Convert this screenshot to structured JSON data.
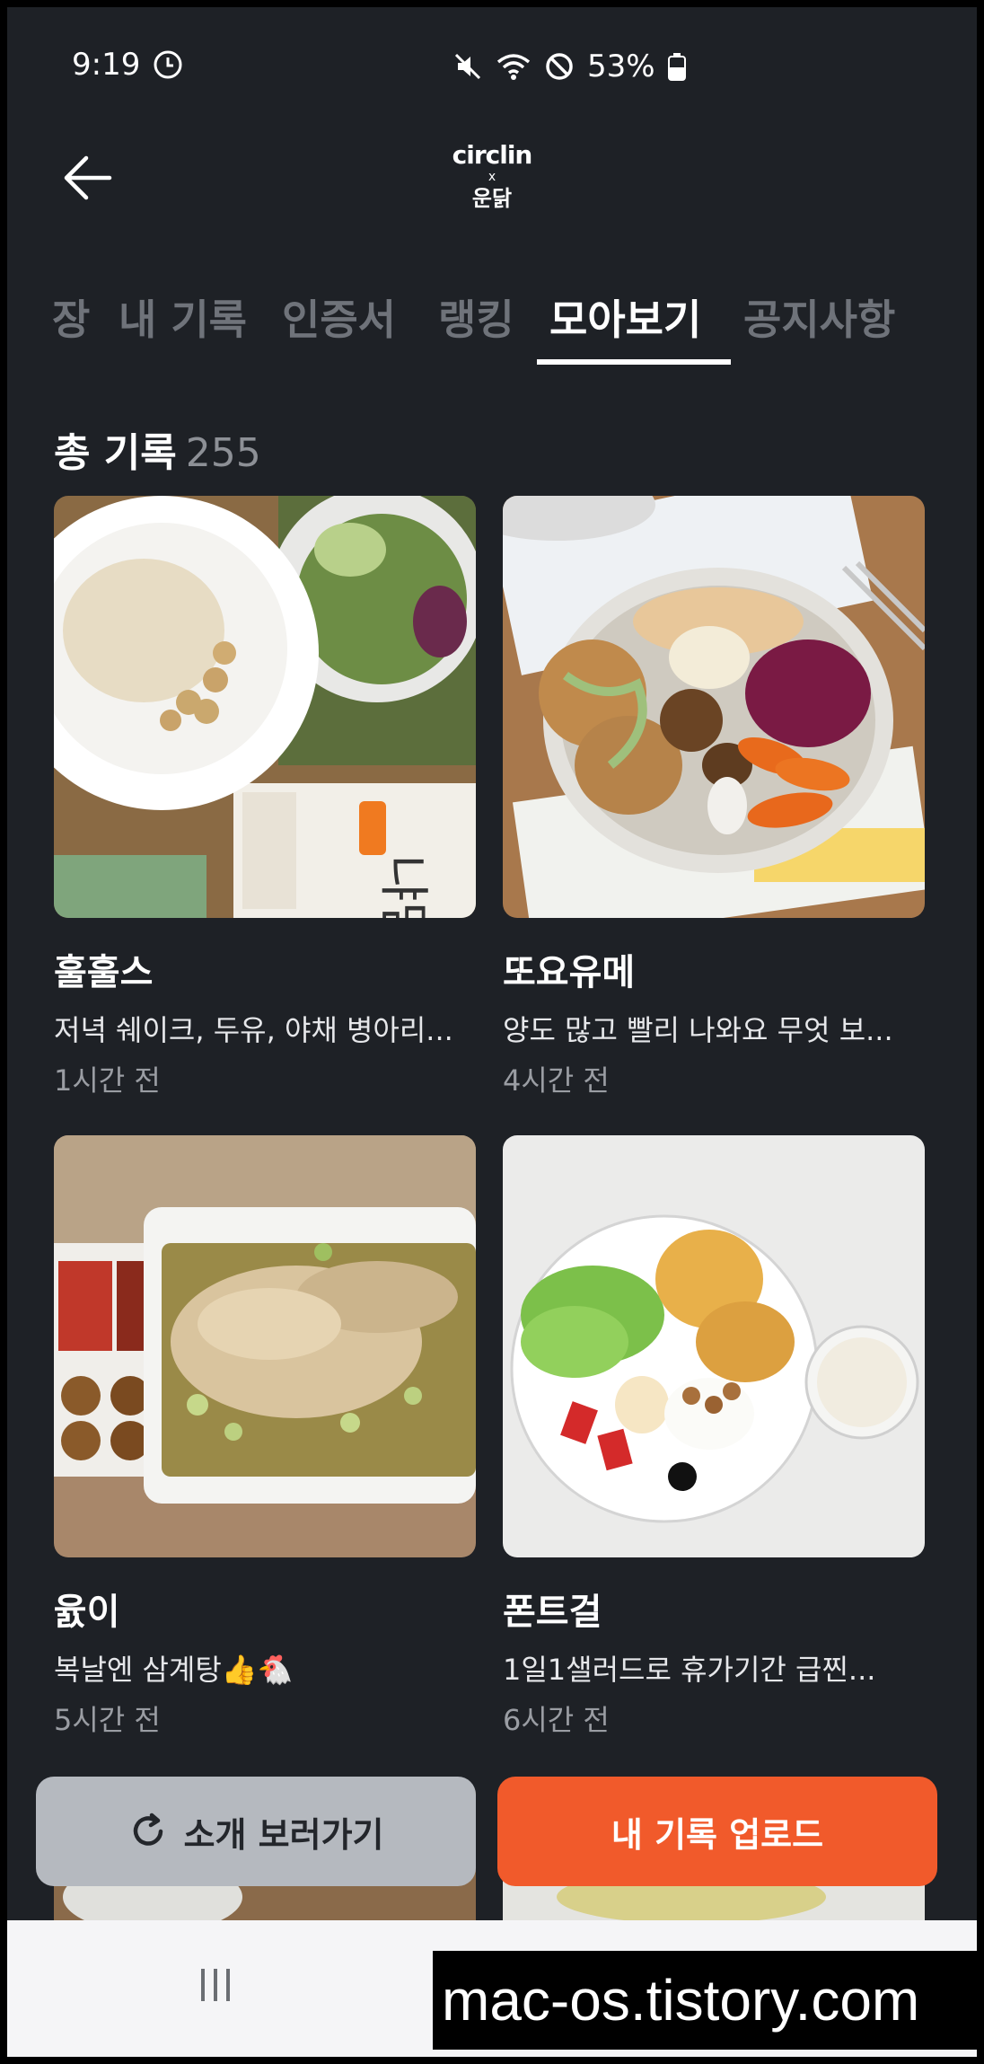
{
  "status_bar": {
    "time": "9:19",
    "battery": "53%"
  },
  "header": {
    "logo_top": "circlin",
    "logo_x": "x",
    "logo_bottom": "운닭"
  },
  "tabs": [
    {
      "label": "장"
    },
    {
      "label": "내 기록"
    },
    {
      "label": "인증서"
    },
    {
      "label": "랭킹"
    },
    {
      "label": "모아보기",
      "active": true
    },
    {
      "label": "공지사항"
    }
  ],
  "summary": {
    "label": "총 기록",
    "count": "255"
  },
  "cards": [
    {
      "name": "훌훌스",
      "description": "저녁 쉐이크, 두유, 야채 병아리...",
      "time": "1시간 전"
    },
    {
      "name": "또요유메",
      "description": "양도 많고 빨리 나와요 무엇 보...",
      "time": "4시간 전"
    },
    {
      "name": "윬이",
      "description": "복날엔 삼계탕👍🐔",
      "time": "5시간 전"
    },
    {
      "name": "폰트걸",
      "description": "1일1샐러드로 휴가기간 급찐...",
      "time": "6시간 전"
    }
  ],
  "buttons": {
    "back_to_intro": "소개 보러가기",
    "upload": "내 기록 업로드"
  },
  "watermark": "mac-os.tistory.com",
  "colors": {
    "background": "#1e2126",
    "accent": "#f15a2b",
    "secondary_button": "#b5b9bf"
  }
}
